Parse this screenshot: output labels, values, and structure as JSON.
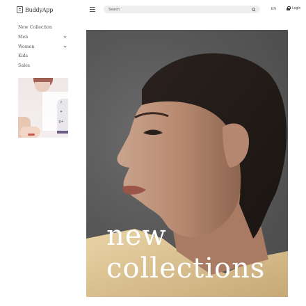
{
  "header": {
    "logo_text": "BuddyApp",
    "search": {
      "placeholder": "Search"
    },
    "language": "EN",
    "login_label": "Login"
  },
  "sidebar": {
    "items": [
      {
        "label": "New Collection",
        "has_submenu": false
      },
      {
        "label": "Men",
        "has_submenu": true
      },
      {
        "label": "Women",
        "has_submenu": true
      },
      {
        "label": "Kids",
        "has_submenu": false
      },
      {
        "label": "Sales",
        "has_submenu": false
      }
    ],
    "promo": {
      "social_icons": [
        "facebook-icon",
        "twitter-icon",
        "google-plus-icon"
      ]
    }
  },
  "hero": {
    "line1": "new",
    "line2": "collections"
  }
}
